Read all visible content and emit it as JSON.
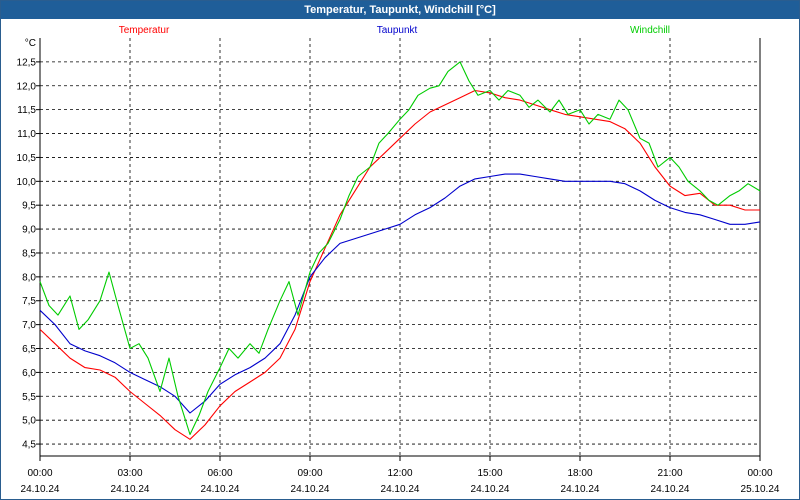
{
  "window": {
    "title": "Temperatur, Taupunkt, Windchill [°C]"
  },
  "chart_data": {
    "type": "line",
    "title": "Temperatur, Taupunkt, Windchill [°C]",
    "ylabel": "°C",
    "ylim": [
      4.25,
      13.0
    ],
    "yticks": [
      "4,5",
      "5,0",
      "5,5",
      "6,0",
      "6,5",
      "7,0",
      "7,5",
      "8,0",
      "8,5",
      "9,0",
      "9,5",
      "10,0",
      "10,5",
      "11,0",
      "11,5",
      "12,0",
      "12,5"
    ],
    "xlim": [
      0,
      24
    ],
    "xticks": [
      {
        "time": "00:00",
        "date": "24.10.24"
      },
      {
        "time": "03:00",
        "date": "24.10.24"
      },
      {
        "time": "06:00",
        "date": "24.10.24"
      },
      {
        "time": "09:00",
        "date": "24.10.24"
      },
      {
        "time": "12:00",
        "date": "24.10.24"
      },
      {
        "time": "15:00",
        "date": "24.10.24"
      },
      {
        "time": "18:00",
        "date": "24.10.24"
      },
      {
        "time": "21:00",
        "date": "24.10.24"
      },
      {
        "time": "00:00",
        "date": "25.10.24"
      }
    ],
    "grid": true,
    "legend_placement": "top",
    "series": [
      {
        "name": "Temperatur",
        "color": "#ff0000",
        "points": [
          [
            0,
            6.9
          ],
          [
            0.5,
            6.6
          ],
          [
            1,
            6.3
          ],
          [
            1.5,
            6.1
          ],
          [
            2,
            6.05
          ],
          [
            2.5,
            5.9
          ],
          [
            3,
            5.6
          ],
          [
            3.5,
            5.35
          ],
          [
            4,
            5.1
          ],
          [
            4.5,
            4.8
          ],
          [
            5,
            4.6
          ],
          [
            5.5,
            4.9
          ],
          [
            6,
            5.3
          ],
          [
            6.5,
            5.6
          ],
          [
            7,
            5.8
          ],
          [
            7.5,
            6.0
          ],
          [
            8,
            6.3
          ],
          [
            8.5,
            6.9
          ],
          [
            9,
            7.9
          ],
          [
            9.5,
            8.6
          ],
          [
            10,
            9.3
          ],
          [
            10.5,
            9.8
          ],
          [
            11,
            10.3
          ],
          [
            11.5,
            10.6
          ],
          [
            12,
            10.9
          ],
          [
            12.5,
            11.2
          ],
          [
            13,
            11.45
          ],
          [
            13.5,
            11.6
          ],
          [
            14,
            11.75
          ],
          [
            14.5,
            11.9
          ],
          [
            15,
            11.85
          ],
          [
            15.5,
            11.75
          ],
          [
            16,
            11.7
          ],
          [
            16.5,
            11.6
          ],
          [
            17,
            11.5
          ],
          [
            17.5,
            11.4
          ],
          [
            18,
            11.35
          ],
          [
            18.5,
            11.3
          ],
          [
            19,
            11.25
          ],
          [
            19.5,
            11.1
          ],
          [
            20,
            10.8
          ],
          [
            20.5,
            10.3
          ],
          [
            21,
            9.9
          ],
          [
            21.5,
            9.7
          ],
          [
            22,
            9.75
          ],
          [
            22.5,
            9.5
          ],
          [
            23,
            9.5
          ],
          [
            23.5,
            9.4
          ],
          [
            24,
            9.4
          ]
        ]
      },
      {
        "name": "Taupunkt",
        "color": "#0000cc",
        "points": [
          [
            0,
            7.3
          ],
          [
            0.5,
            7.0
          ],
          [
            1,
            6.6
          ],
          [
            1.5,
            6.45
          ],
          [
            2,
            6.35
          ],
          [
            2.5,
            6.2
          ],
          [
            3,
            6.0
          ],
          [
            3.5,
            5.85
          ],
          [
            4,
            5.7
          ],
          [
            4.5,
            5.5
          ],
          [
            5,
            5.15
          ],
          [
            5.5,
            5.4
          ],
          [
            6,
            5.75
          ],
          [
            6.5,
            5.95
          ],
          [
            7,
            6.1
          ],
          [
            7.5,
            6.3
          ],
          [
            8,
            6.6
          ],
          [
            8.5,
            7.2
          ],
          [
            9,
            8.0
          ],
          [
            9.5,
            8.4
          ],
          [
            10,
            8.7
          ],
          [
            10.5,
            8.8
          ],
          [
            11,
            8.9
          ],
          [
            11.5,
            9.0
          ],
          [
            12,
            9.1
          ],
          [
            12.5,
            9.3
          ],
          [
            13,
            9.45
          ],
          [
            13.5,
            9.65
          ],
          [
            14,
            9.9
          ],
          [
            14.5,
            10.05
          ],
          [
            15,
            10.1
          ],
          [
            15.5,
            10.15
          ],
          [
            16,
            10.15
          ],
          [
            16.5,
            10.1
          ],
          [
            17,
            10.05
          ],
          [
            17.5,
            10.0
          ],
          [
            18,
            10.0
          ],
          [
            18.5,
            10.0
          ],
          [
            19,
            10.0
          ],
          [
            19.5,
            9.95
          ],
          [
            20,
            9.8
          ],
          [
            20.5,
            9.6
          ],
          [
            21,
            9.45
          ],
          [
            21.5,
            9.35
          ],
          [
            22,
            9.3
          ],
          [
            22.5,
            9.2
          ],
          [
            23,
            9.1
          ],
          [
            23.5,
            9.1
          ],
          [
            24,
            9.15
          ]
        ]
      },
      {
        "name": "Windchill",
        "color": "#00cc00",
        "points": [
          [
            0,
            7.9
          ],
          [
            0.3,
            7.4
          ],
          [
            0.6,
            7.2
          ],
          [
            1,
            7.6
          ],
          [
            1.3,
            6.9
          ],
          [
            1.6,
            7.1
          ],
          [
            2,
            7.5
          ],
          [
            2.3,
            8.1
          ],
          [
            2.6,
            7.4
          ],
          [
            3,
            6.5
          ],
          [
            3.3,
            6.6
          ],
          [
            3.6,
            6.3
          ],
          [
            4,
            5.6
          ],
          [
            4.3,
            6.3
          ],
          [
            4.6,
            5.5
          ],
          [
            5,
            4.7
          ],
          [
            5.3,
            5.1
          ],
          [
            5.6,
            5.6
          ],
          [
            6,
            6.1
          ],
          [
            6.3,
            6.5
          ],
          [
            6.6,
            6.3
          ],
          [
            7,
            6.6
          ],
          [
            7.3,
            6.4
          ],
          [
            7.6,
            6.9
          ],
          [
            8,
            7.5
          ],
          [
            8.3,
            7.9
          ],
          [
            8.6,
            7.2
          ],
          [
            9,
            8.1
          ],
          [
            9.3,
            8.5
          ],
          [
            9.6,
            8.7
          ],
          [
            10,
            9.2
          ],
          [
            10.3,
            9.7
          ],
          [
            10.6,
            10.1
          ],
          [
            11,
            10.3
          ],
          [
            11.3,
            10.8
          ],
          [
            11.6,
            11.0
          ],
          [
            12,
            11.3
          ],
          [
            12.3,
            11.5
          ],
          [
            12.6,
            11.8
          ],
          [
            13,
            11.95
          ],
          [
            13.3,
            12.0
          ],
          [
            13.6,
            12.3
          ],
          [
            14,
            12.5
          ],
          [
            14.3,
            12.1
          ],
          [
            14.6,
            11.8
          ],
          [
            15,
            11.9
          ],
          [
            15.3,
            11.7
          ],
          [
            15.6,
            11.9
          ],
          [
            16,
            11.8
          ],
          [
            16.3,
            11.55
          ],
          [
            16.6,
            11.7
          ],
          [
            17,
            11.45
          ],
          [
            17.3,
            11.7
          ],
          [
            17.6,
            11.4
          ],
          [
            18,
            11.5
          ],
          [
            18.3,
            11.2
          ],
          [
            18.6,
            11.4
          ],
          [
            19,
            11.3
          ],
          [
            19.3,
            11.7
          ],
          [
            19.6,
            11.5
          ],
          [
            20,
            10.9
          ],
          [
            20.3,
            10.8
          ],
          [
            20.6,
            10.3
          ],
          [
            21,
            10.5
          ],
          [
            21.3,
            10.3
          ],
          [
            21.6,
            10.0
          ],
          [
            22,
            9.8
          ],
          [
            22.3,
            9.6
          ],
          [
            22.6,
            9.5
          ],
          [
            23,
            9.7
          ],
          [
            23.3,
            9.8
          ],
          [
            23.6,
            9.95
          ],
          [
            24,
            9.8
          ]
        ]
      }
    ]
  }
}
